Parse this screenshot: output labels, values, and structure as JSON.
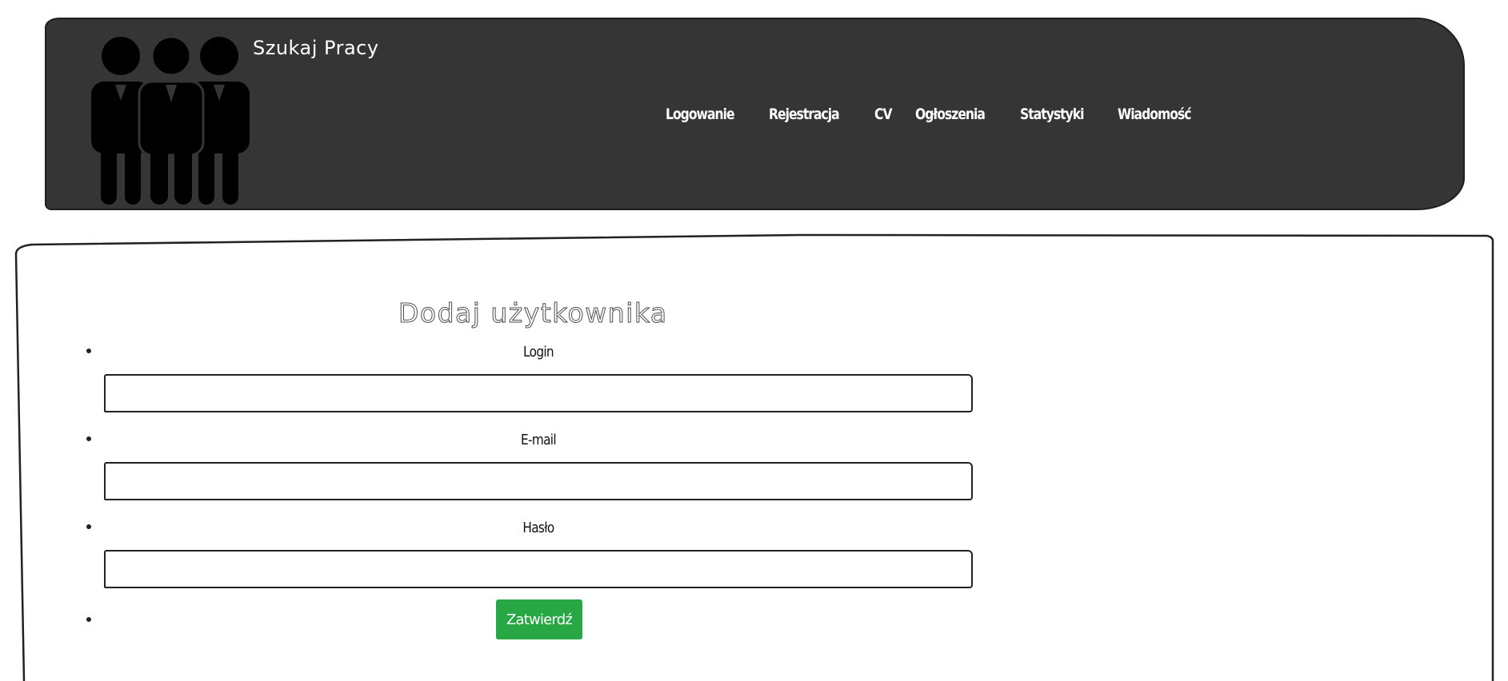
{
  "header": {
    "site_title": "Szukaj Pracy",
    "logo_icon": "people-group-icon",
    "background": "#353535"
  },
  "nav": {
    "items": [
      {
        "label": "Logowanie"
      },
      {
        "label": "Rejestracja"
      },
      {
        "label": "CV"
      },
      {
        "label": "Ogłoszenia"
      },
      {
        "label": "Statystyki"
      },
      {
        "label": "Wiadomość"
      }
    ]
  },
  "form": {
    "title": "Dodaj użytkownika",
    "fields": [
      {
        "label": "Login",
        "value": ""
      },
      {
        "label": "E-mail",
        "value": ""
      },
      {
        "label": "Hasło",
        "value": ""
      }
    ],
    "submit_label": "Zatwierdź",
    "submit_color": "#28a745"
  }
}
